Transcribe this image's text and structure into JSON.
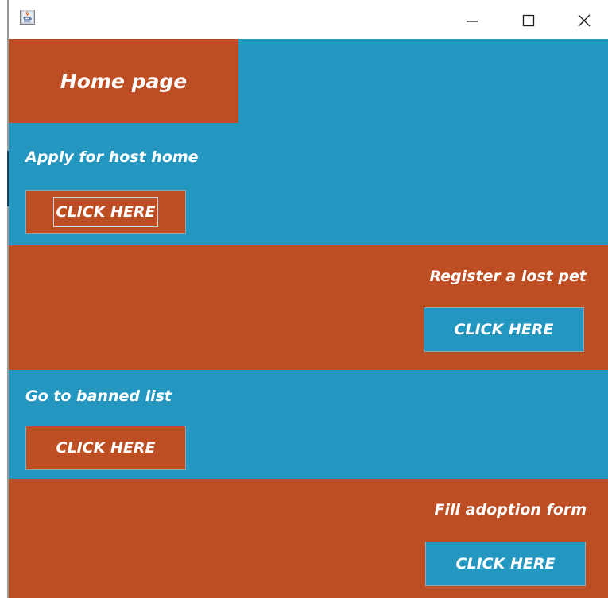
{
  "window": {
    "icons": {
      "app": "java-app-icon",
      "minimize": "minimize-icon",
      "maximize": "maximize-icon",
      "close": "close-icon"
    }
  },
  "header": {
    "title": "Home page"
  },
  "sections": [
    {
      "label": "Apply for host home",
      "button": "CLICK HERE",
      "focused": true
    },
    {
      "label": "Register a lost pet",
      "button": "CLICK HERE"
    },
    {
      "label": "Go to banned list",
      "button": "CLICK HERE"
    },
    {
      "label": "Fill adoption form",
      "button": "CLICK HERE"
    }
  ],
  "colors": {
    "blue": "#2497c0",
    "orange": "#bd4e24",
    "text": "#ffffff"
  }
}
